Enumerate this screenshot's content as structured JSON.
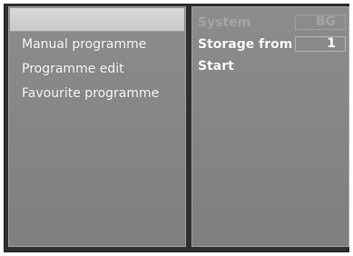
{
  "menu": {
    "items": [
      {
        "label": ""
      },
      {
        "label": "Manual programme"
      },
      {
        "label": "Programme edit"
      },
      {
        "label": "Favourite programme"
      }
    ]
  },
  "settings": {
    "system_label": "System",
    "system_value": "BG",
    "storage_label": "Storage from",
    "storage_value": "1",
    "start_label": "Start"
  }
}
